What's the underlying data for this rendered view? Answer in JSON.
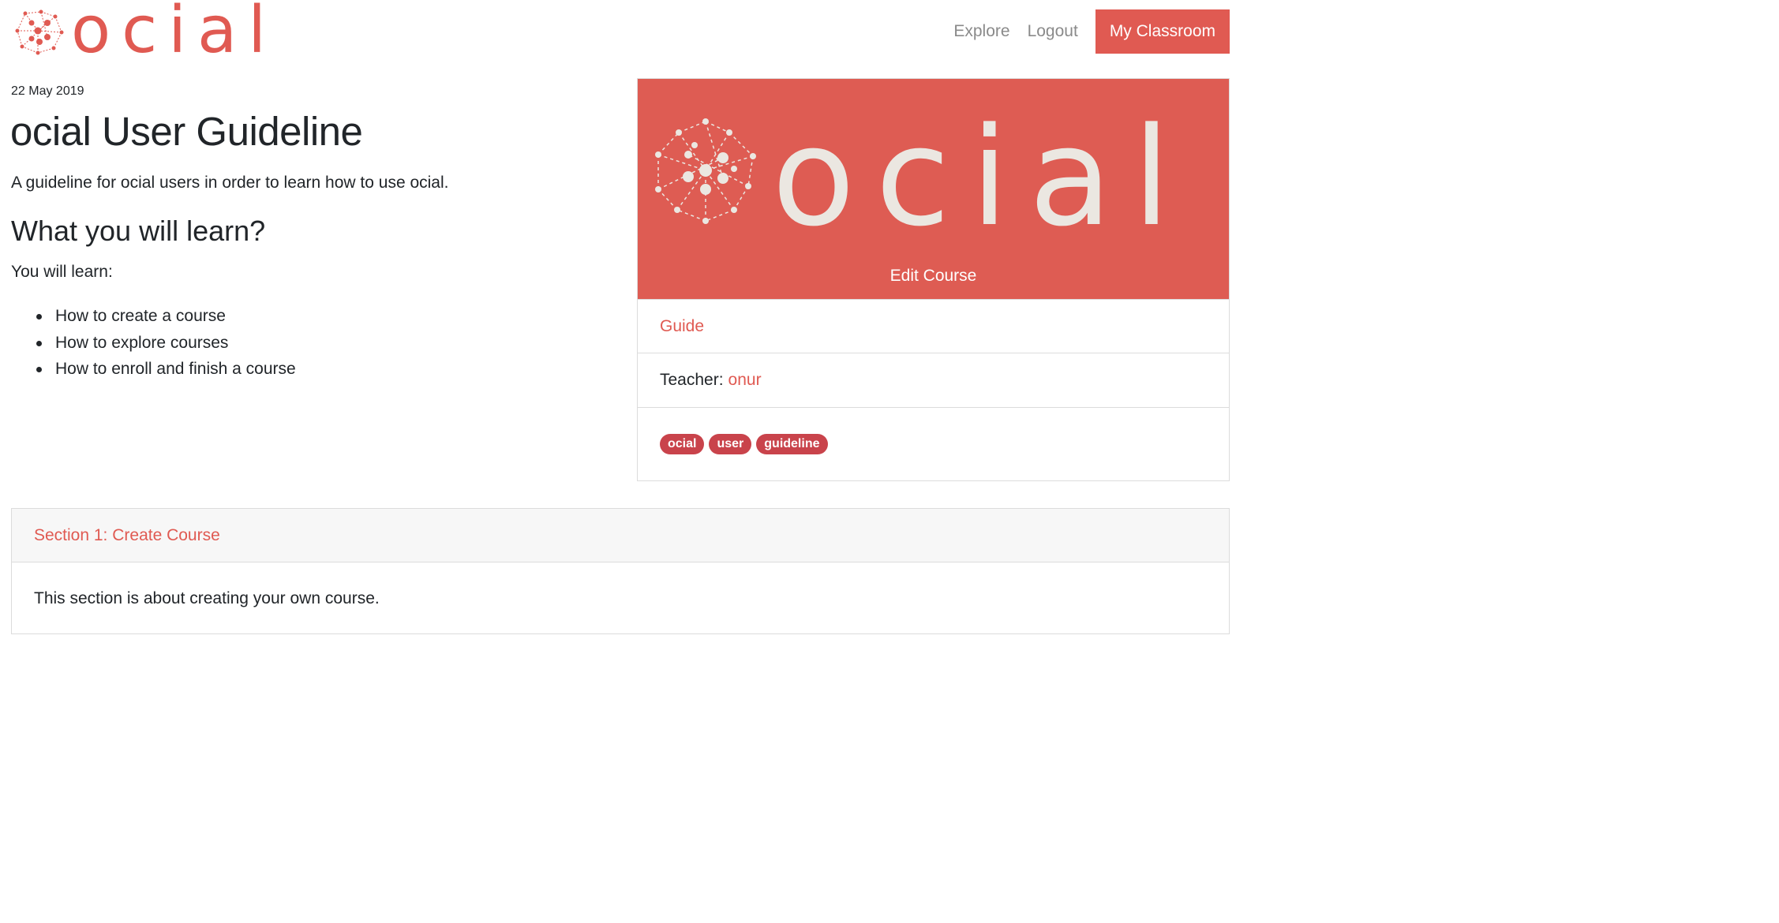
{
  "navbar": {
    "brand_text": "ocial",
    "links": [
      "Explore",
      "Logout"
    ],
    "cta_label": "My Classroom"
  },
  "course": {
    "date": "22 May 2019",
    "title": "ocial User Guideline",
    "description": "A guideline for ocial users in order to learn how to use ocial.",
    "learn_heading": "What you will learn?",
    "learn_intro": "You will learn:",
    "learn_items": [
      "How to create a course",
      "How to explore courses",
      "How to enroll and finish a course"
    ]
  },
  "card": {
    "banner_text": "ocial",
    "edit_label": "Edit Course",
    "category": "Guide",
    "teacher_label": "Teacher:",
    "teacher_name": "onur",
    "tags": [
      "ocial",
      "user",
      "guideline"
    ]
  },
  "section": {
    "title": "Section 1: Create Course",
    "body": "This section is about creating your own course."
  },
  "colors": {
    "accent": "#e05a52",
    "banner": "#de5c53",
    "tag": "#c9434b",
    "banner_logo": "#ebe7e1"
  }
}
